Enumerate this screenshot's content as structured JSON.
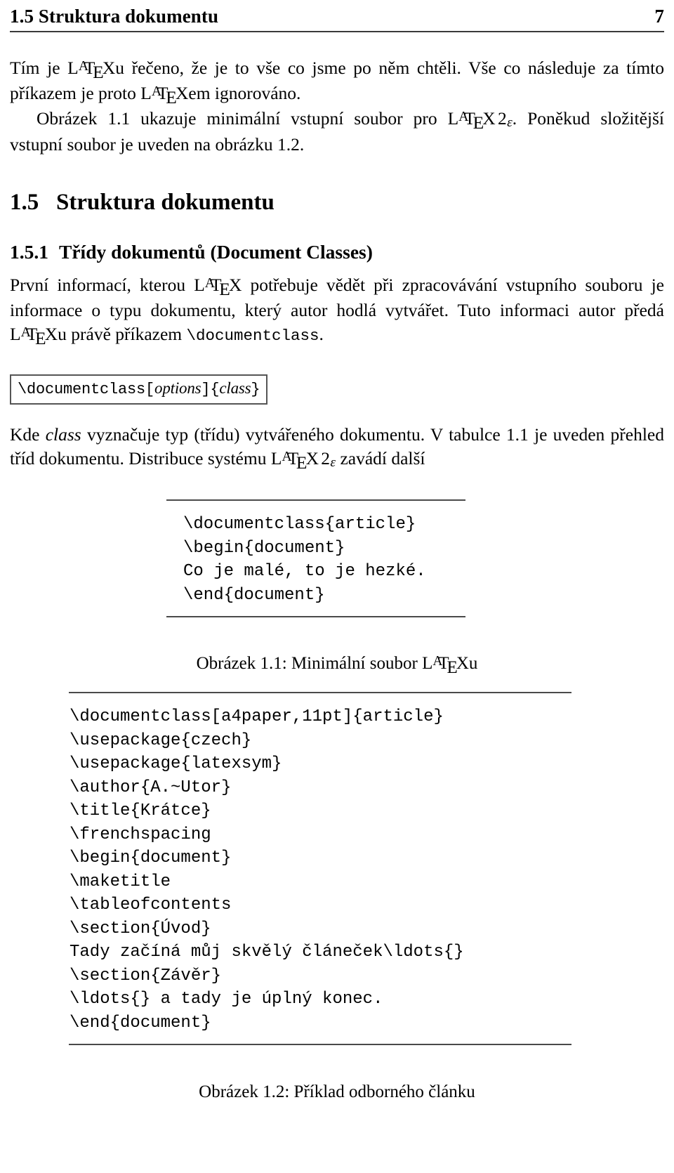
{
  "header": {
    "section_title": "1.5  Struktura dokumentu",
    "page_number": "7"
  },
  "body": {
    "paragraph_1_part_a": "Tím je ",
    "paragraph_1_part_b": "u řečeno, že je to vše co jsme po něm chtěli. Vše co následuje za tímto příkazem je proto ",
    "paragraph_1_part_c": "em ignorováno.",
    "paragraph_2_part_a": "Obrázek 1.1 ukazuje minimální vstupní soubor pro ",
    "paragraph_2_part_b": ". Poněkud složitější vstupní soubor je uveden na obrázku 1.2.",
    "section_number": "1.5",
    "section_title": "Struktura dokumentu",
    "subsection_number": "1.5.1",
    "subsection_title": "Třídy dokumentů (Document Classes)",
    "paragraph_3_part_a": "První informací, kterou ",
    "paragraph_3_part_b": " potřebuje vědět při zpracovávání vstupního souboru je informace o typu dokumentu, který autor hodlá vytvářet. Tuto informaci autor předá ",
    "paragraph_3_part_c": "u právě příkazem ",
    "paragraph_3_command": "\\documentclass",
    "paragraph_3_part_d": ".",
    "paragraph_4_part_a": "Kde ",
    "paragraph_4_italic": "class",
    "paragraph_4_part_b": " vyznačuje typ (třídu) vytvářeného dokumentu. V tabulce 1.1 je uveden přehled tříd dokumentu. Distribuce systému ",
    "paragraph_4_part_c": " zavádí další"
  },
  "command_box": {
    "prefix": "\\documentclass[",
    "arg_options": "options",
    "middle": "]{",
    "arg_class": "class",
    "suffix": "}"
  },
  "figure_1": {
    "code": "\\documentclass{article}\n\\begin{document}\nCo je malé, to je hezké.\n\\end{document}",
    "caption_part_a": "Obrázek 1.1: Minimální soubor ",
    "caption_part_b": "u"
  },
  "figure_2": {
    "code": "\\documentclass[a4paper,11pt]{article}\n\\usepackage{czech}\n\\usepackage{latexsym}\n\\author{A.~Utor}\n\\title{Krátce}\n\\frenchspacing\n\\begin{document}\n\\maketitle\n\\tableofcontents\n\\section{Úvod}\nTady začíná můj skvělý článeček\\ldots{}\n\\section{Závěr}\n\\ldots{} a tady je úplný konec.\n\\end{document}",
    "caption": "Obrázek 1.2: Příklad odborného článku"
  },
  "latex_logo": {
    "l": "L",
    "a": "A",
    "t": "T",
    "e": "E",
    "x": "X",
    "two": "2",
    "epsilon": "ε"
  },
  "colors": {
    "text": "#000000",
    "background": "#ffffff",
    "rule": "#4a4a4a"
  }
}
